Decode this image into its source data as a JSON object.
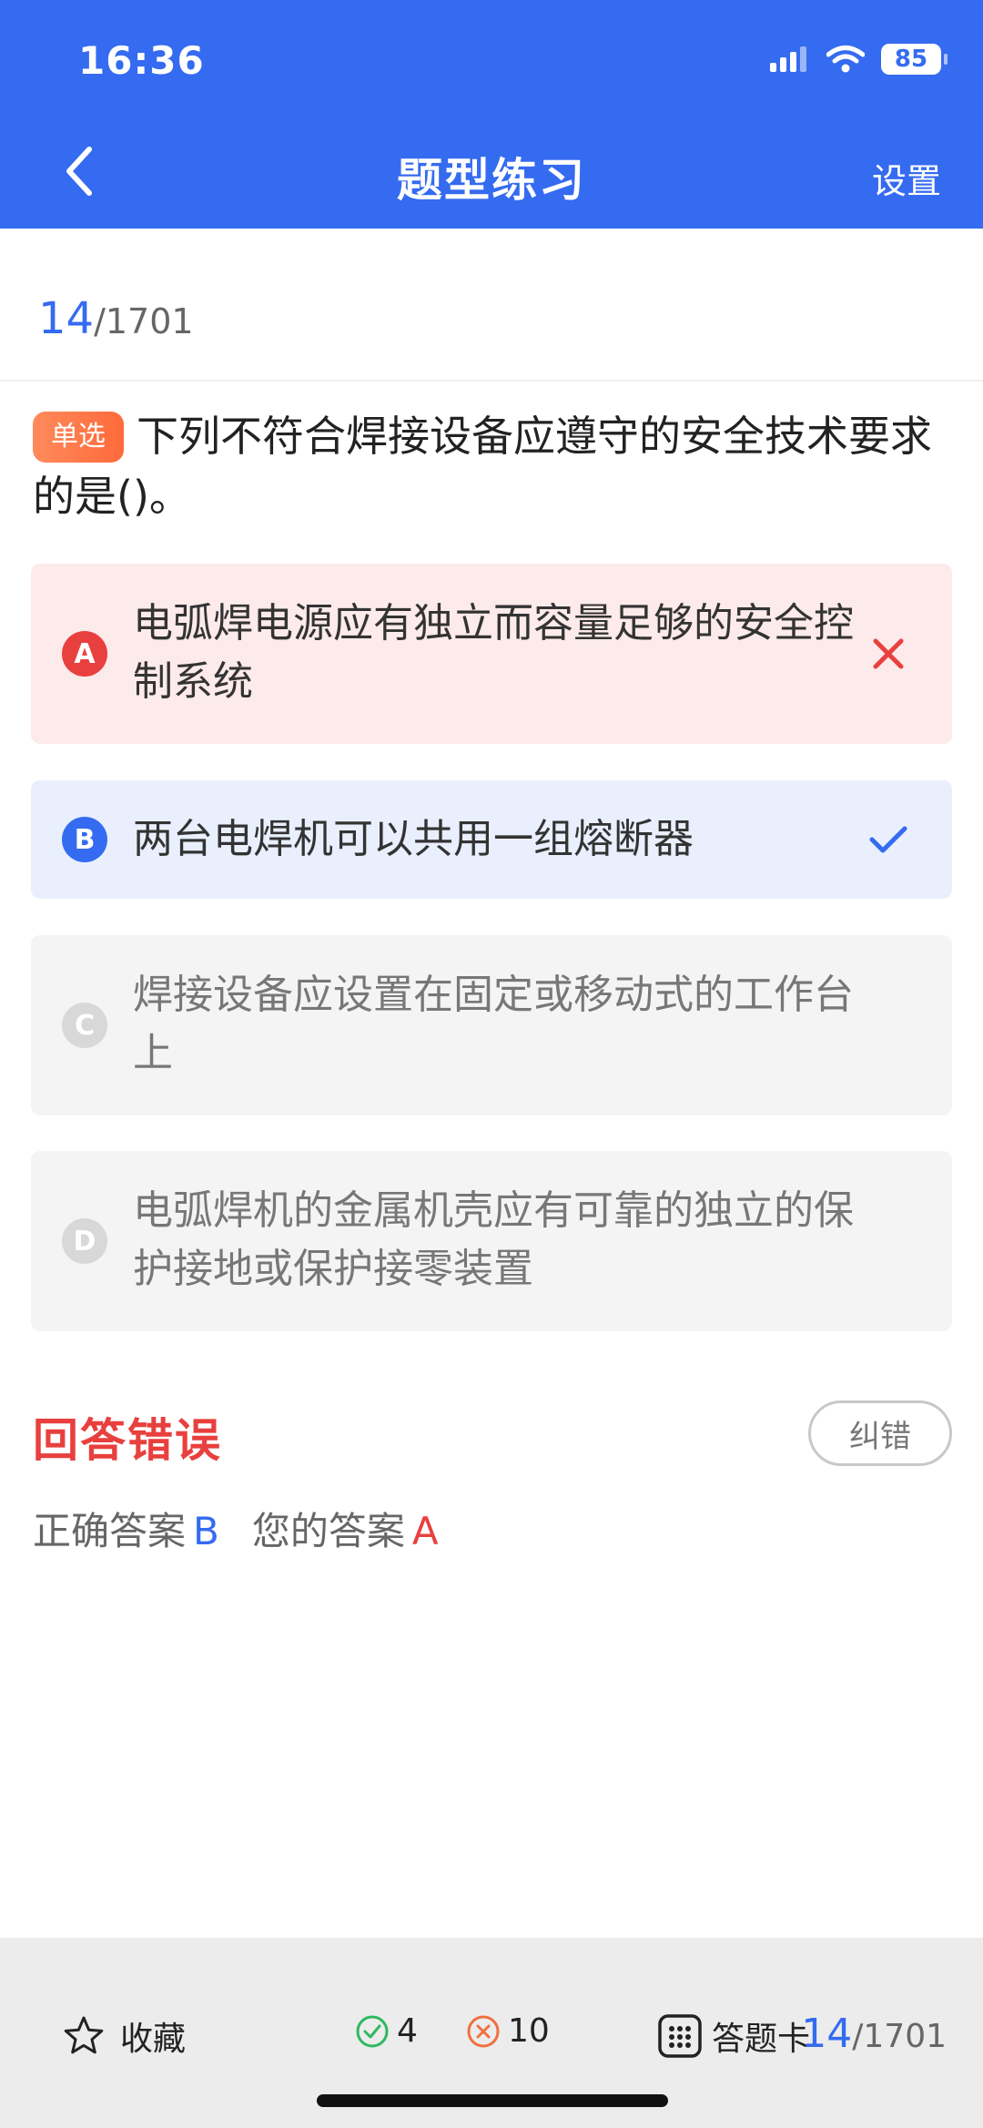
{
  "status_bar": {
    "time": "16:36",
    "battery": "85"
  },
  "nav": {
    "title": "题型练习",
    "settings_label": "设置"
  },
  "progress": {
    "current": "14",
    "total": "/1701"
  },
  "question": {
    "type_tag": "单选",
    "text": "下列不符合焊接设备应遵守的安全技术要求的是()。"
  },
  "options": [
    {
      "letter": "A",
      "text": "电弧焊电源应有独立而容量足够的安全控制系统",
      "state": "wrong-selected"
    },
    {
      "letter": "B",
      "text": "两台电焊机可以共用一组熔断器",
      "state": "correct"
    },
    {
      "letter": "C",
      "text": "焊接设备应设置在固定或移动式的工作台上",
      "state": "neutral"
    },
    {
      "letter": "D",
      "text": "电弧焊机的金属机壳应有可靠的独立的保护接地或保护接零装置",
      "state": "neutral"
    }
  ],
  "result": {
    "title": "回答错误",
    "correction_label": "纠错",
    "correct_label": "正确答案",
    "correct_value": "B",
    "yours_label": "您的答案",
    "yours_value": "A"
  },
  "bottom_bar": {
    "favorite_label": "收藏",
    "right_count": "4",
    "wrong_count": "10",
    "card_label": "答题卡",
    "current": "14",
    "total": "/1701"
  },
  "colors": {
    "primary": "#356bf0",
    "error": "#e8403e",
    "tag": "#ff7a4a"
  },
  "icons": [
    "signal-icon",
    "wifi-icon",
    "battery-icon",
    "back-chevron-icon",
    "wrong-x-icon",
    "check-icon",
    "star-icon",
    "check-circle-icon",
    "x-circle-icon",
    "grid-icon"
  ]
}
